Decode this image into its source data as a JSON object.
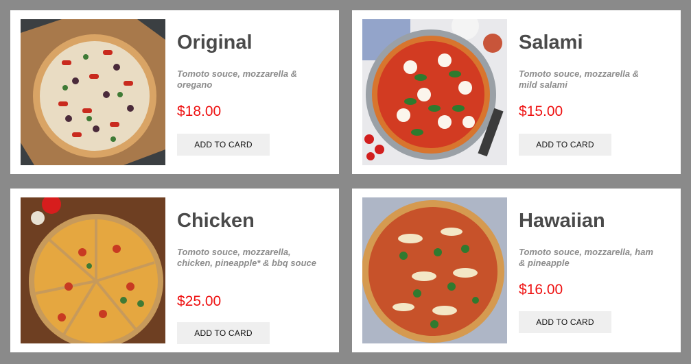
{
  "products": [
    {
      "name": "Original",
      "description": "Tomoto souce, mozzarella & oregano",
      "price": "$18.00",
      "button_label": "ADD TO CARD",
      "image_icon": "pizza-original-image"
    },
    {
      "name": "Salami",
      "description": "Tomoto souce, mozzarella & mild salami",
      "price": "$15.00",
      "button_label": "ADD TO CARD",
      "image_icon": "pizza-salami-image"
    },
    {
      "name": "Chicken",
      "description": "Tomoto souce, mozzarella, chicken, pineapple* & bbq souce",
      "price": "$25.00",
      "button_label": "ADD TO CARD",
      "image_icon": "pizza-chicken-image"
    },
    {
      "name": "Hawaiian",
      "description": "Tomoto souce, mozzarella, ham & pineapple",
      "price": "$16.00",
      "button_label": "ADD TO CARD",
      "image_icon": "pizza-hawaiian-image"
    }
  ],
  "colors": {
    "page_background": "#8a8a8a",
    "card_background": "#ffffff",
    "title_color": "#4a4a4a",
    "description_color": "#8c8c8c",
    "price_color": "#ee1111",
    "button_background": "#efefef"
  }
}
